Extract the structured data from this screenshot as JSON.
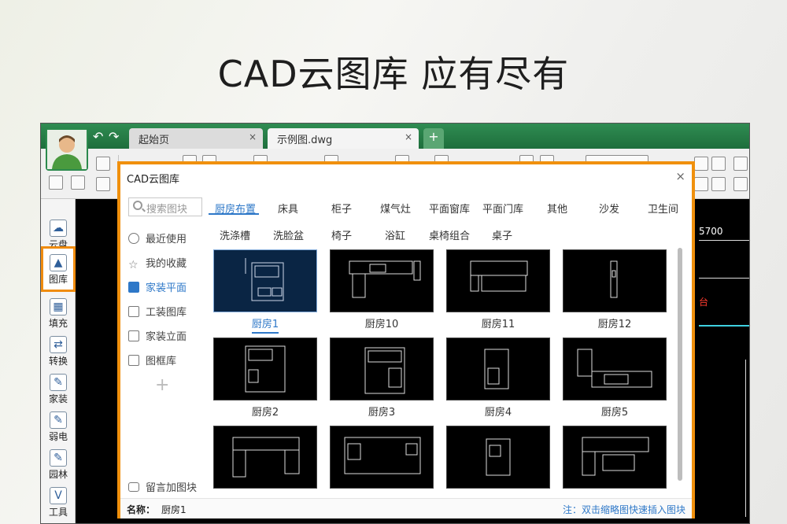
{
  "headline": "CAD云图库  应有尽有",
  "app": {
    "tabs": [
      {
        "label": "起始页",
        "close": "×"
      },
      {
        "label": "示例图.dwg",
        "close": "×"
      }
    ],
    "new_tab": "+",
    "sidebar": [
      {
        "label": "云盘",
        "icon": "cloud-icon",
        "glyph": "☁"
      },
      {
        "label": "图库",
        "icon": "image-library-icon",
        "glyph": "▲"
      },
      {
        "label": "填充",
        "icon": "hatch-icon",
        "glyph": "▦"
      },
      {
        "label": "转换",
        "icon": "convert-icon",
        "glyph": "⇄"
      },
      {
        "label": "家装",
        "icon": "home-decor-icon",
        "glyph": "✎"
      },
      {
        "label": "弱电",
        "icon": "low-voltage-icon",
        "glyph": "✎"
      },
      {
        "label": "园林",
        "icon": "garden-icon",
        "glyph": "✎"
      },
      {
        "label": "工具",
        "icon": "tools-icon",
        "glyph": "V"
      }
    ],
    "canvas_text": {
      "dim": "5700",
      "red_label": "台"
    }
  },
  "dialog": {
    "title": "CAD云图库",
    "close": "×",
    "search_placeholder": "搜索图块",
    "left_nav": [
      "最近使用",
      "我的收藏",
      "家装平面",
      "工装图库",
      "家装立面",
      "图框库"
    ],
    "left_nav_selected": 2,
    "add": "+",
    "feedback": "留言加图块",
    "categories_row1": [
      "厨房布置",
      "床具",
      "柜子",
      "煤气灶",
      "平面窗库",
      "平面门库",
      "其他",
      "沙发",
      "卫生间"
    ],
    "categories_row2": [
      "洗涤槽",
      "洗脸盆",
      "椅子",
      "浴缸",
      "桌椅组合",
      "桌子"
    ],
    "category_selected": "厨房布置",
    "thumbnails": [
      "厨房1",
      "厨房10",
      "厨房11",
      "厨房12",
      "厨房2",
      "厨房3",
      "厨房4",
      "厨房5",
      "",
      "",
      "",
      ""
    ],
    "thumbnail_selected": "厨房1",
    "footer": {
      "name_label": "名称：",
      "name_value": "厨房1",
      "note": "注：双击缩略图快速插入图块"
    }
  },
  "colors": {
    "accent": "#2e78c8",
    "highlight": "#f0900d",
    "brand_green": "#2b8a4d"
  }
}
